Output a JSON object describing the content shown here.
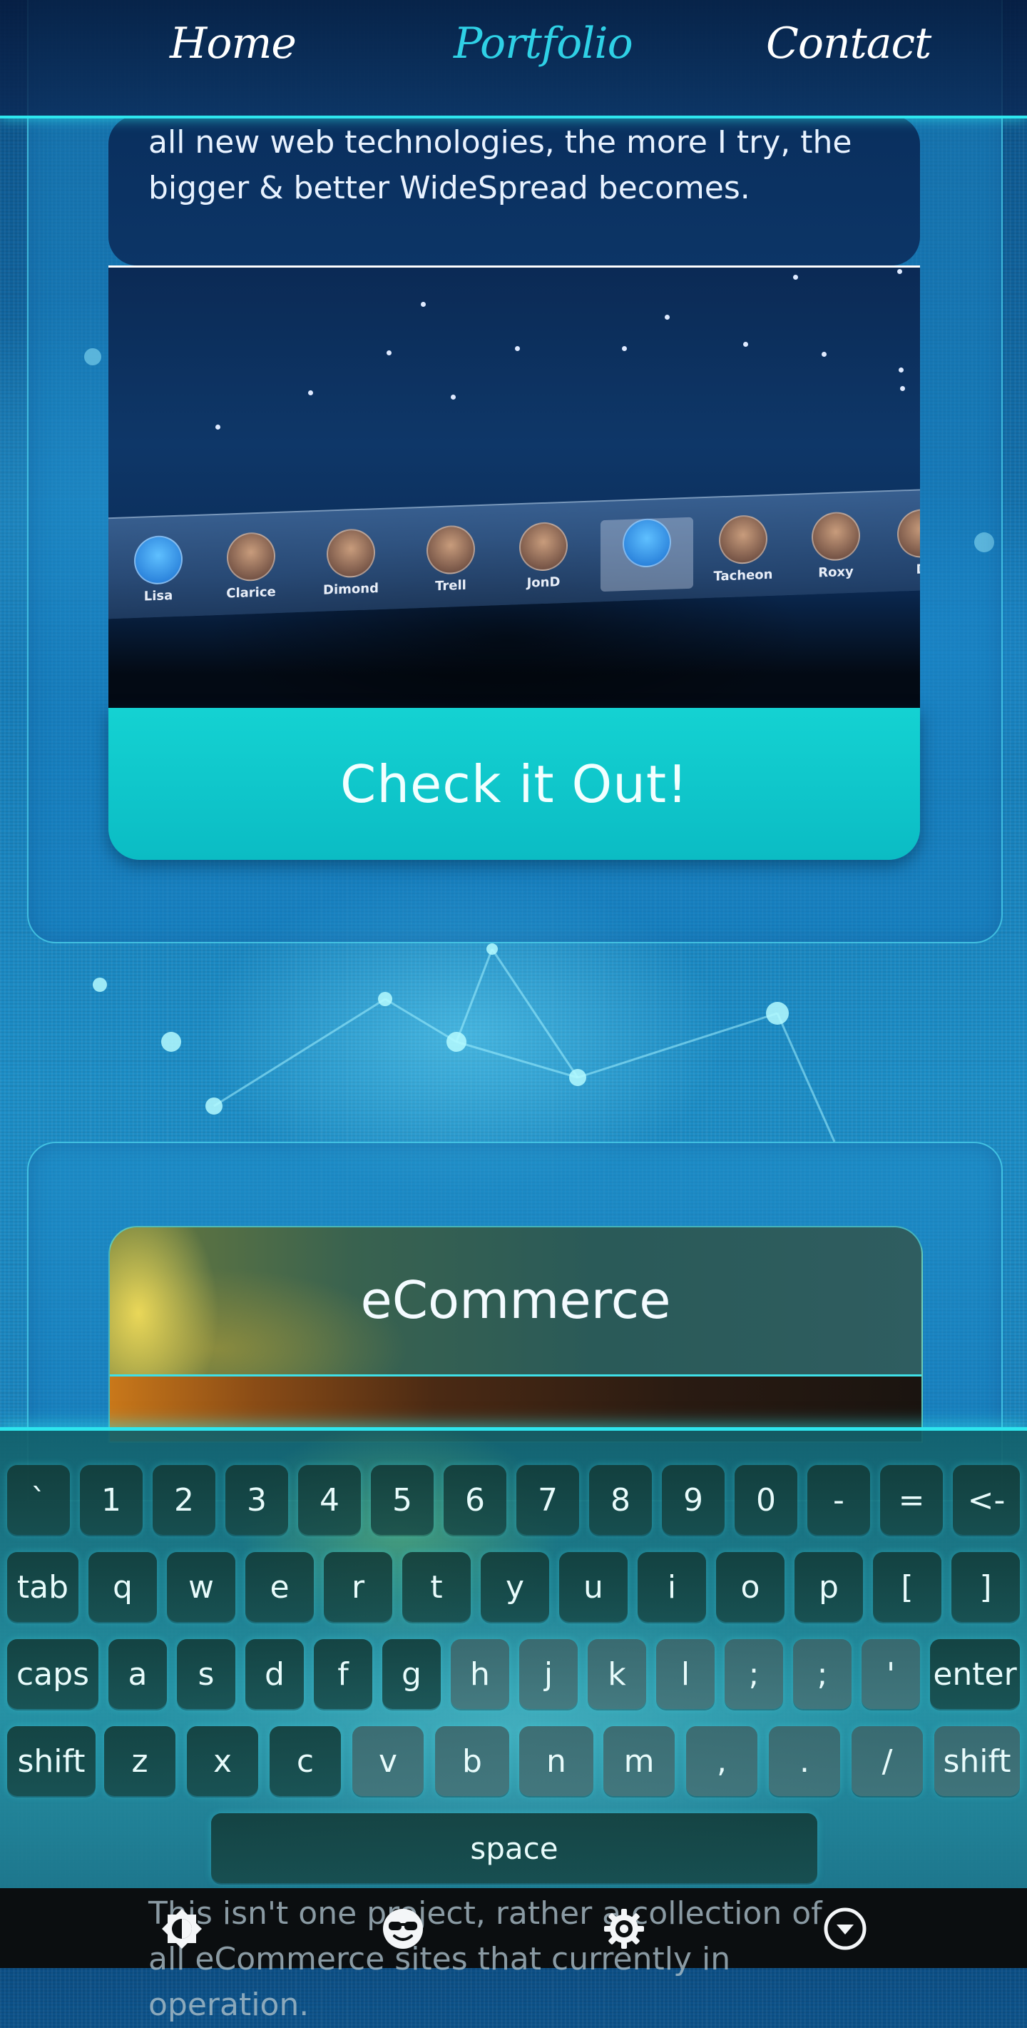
{
  "nav": {
    "items": [
      {
        "label": "Home"
      },
      {
        "label": "Portfolio"
      },
      {
        "label": "Contact"
      }
    ],
    "active": "Portfolio"
  },
  "project_card": {
    "description": "This is my \"playground\". This is where I try out all new web technologies, the more I try, the bigger & better WideSpread becomes.",
    "screenshot_contacts": [
      "Lisa",
      "Clarice",
      "Dimond",
      "Trell",
      "JonD",
      "",
      "Tacheon",
      "Roxy",
      "D"
    ],
    "button_label": "Check it Out!"
  },
  "ecommerce_card": {
    "title": "eCommerce",
    "description": "This isn't one project, rather a collection of all eCommerce sites that currently in operation."
  },
  "keyboard": {
    "row1": [
      "`",
      "1",
      "2",
      "3",
      "4",
      "5",
      "6",
      "7",
      "8",
      "9",
      "0",
      "-",
      "=",
      "<-"
    ],
    "row2": [
      "tab",
      "q",
      "w",
      "e",
      "r",
      "t",
      "y",
      "u",
      "i",
      "o",
      "p",
      "[",
      "]"
    ],
    "row3": [
      "caps",
      "a",
      "s",
      "d",
      "f",
      "g",
      "h",
      "j",
      "k",
      "l",
      ";",
      ";",
      "'",
      "enter"
    ],
    "row4": [
      "shift",
      "z",
      "x",
      "c",
      "v",
      "b",
      "n",
      "m",
      ",",
      ".",
      "/",
      "shift"
    ],
    "space": "space"
  },
  "system_bar": {
    "icons": [
      "brightness-icon",
      "sunglasses-face-icon",
      "settings-gear-icon",
      "dropdown-circle-icon"
    ]
  },
  "colors": {
    "accent_cyan": "#2ee6ee",
    "button_teal": "#14d2d2",
    "nav_active": "#2fd1e6",
    "card_dark": "#0a2f5e"
  }
}
